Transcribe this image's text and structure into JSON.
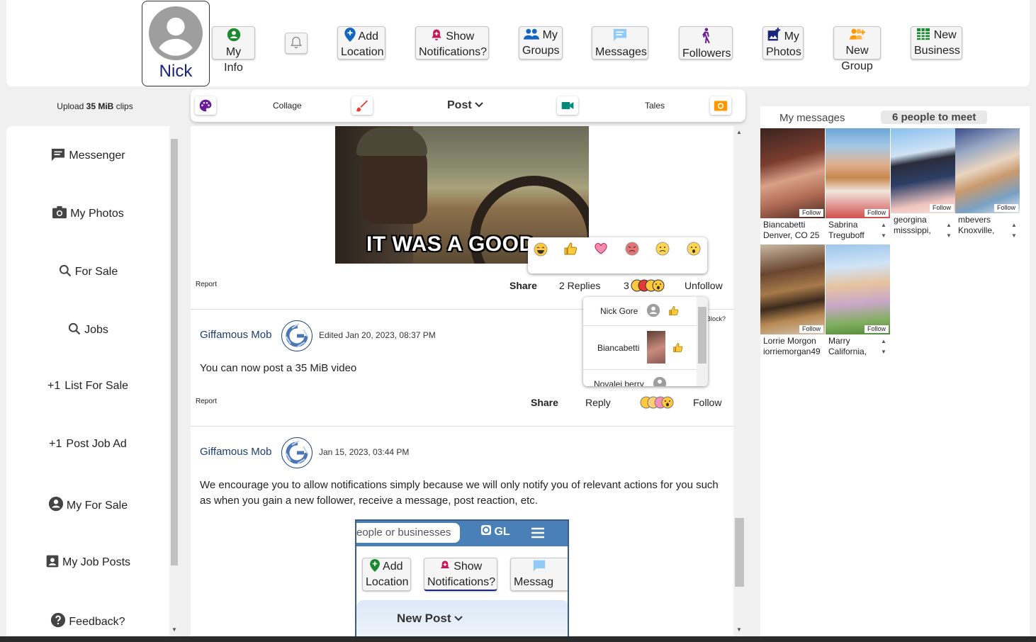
{
  "profile": {
    "name": "Nick"
  },
  "nav": {
    "my_info": "My Info",
    "add": "Add",
    "location": "Location",
    "show": "Show",
    "notifications": "Notifications?",
    "my": "My",
    "groups": "Groups",
    "messages": "Messages",
    "followers": "Followers",
    "photos": "Photos",
    "new": "New",
    "group": "Group",
    "business": "Business"
  },
  "upload": {
    "prefix": "Upload ",
    "size": "35 MiB",
    "suffix": " clips"
  },
  "tabs": {
    "collage": "Collage",
    "post": "Post",
    "tales": "Tales"
  },
  "sidebar": {
    "items": [
      "Messenger",
      "My Photos",
      "For Sale",
      "Jobs",
      "List For Sale",
      "Post Job Ad",
      "My For Sale",
      "My Job Posts",
      "Feedback?"
    ],
    "plus": "+1"
  },
  "post1": {
    "gif_caption": "IT WAS A GOOD",
    "report": "Report",
    "share": "Share",
    "replies": "2 Replies",
    "reaction_count": "3",
    "follow": "Unfollow"
  },
  "reactions_list": {
    "names": [
      "Nick Gore",
      "Biancabetti",
      "Novalei berry"
    ],
    "block": "Block?"
  },
  "post2": {
    "author": "Giffamous Mob",
    "date": "Edited Jan 20, 2023, 08:37 PM",
    "text": "You can now post a 35 MiB video",
    "report": "Report",
    "share": "Share",
    "reply": "Reply",
    "follow": "Follow"
  },
  "post3": {
    "author": "Giffamous Mob",
    "date": "Jan 15, 2023, 03:44 PM",
    "text": "We encourage you to allow notifications simply because we will only notify you of relevant actions for you such as when you gain a new follower, receive a message, post reaction, etc.",
    "shot": {
      "search": "eople or businesses",
      "logo": "GL",
      "add": "Add",
      "location": "Location",
      "show": "Show",
      "notifications": "Notifications?",
      "messages": "Messag",
      "new_post": "New Post"
    }
  },
  "right": {
    "my_messages": "My messages",
    "people": "6 people to meet",
    "follow": "Follow",
    "cards": [
      {
        "l1": "Biancabetti",
        "l2": "Denver, CO 25"
      },
      {
        "l1": "Sabrina",
        "l2": "Treguboff"
      },
      {
        "l1": "georgina",
        "l2": "misssippi,"
      },
      {
        "l1": "mbevers",
        "l2": "Knoxville,"
      },
      {
        "l1": "Lorrie Morgon",
        "l2": "iorriemorgan49"
      },
      {
        "l1": "Marry",
        "l2": "California,"
      }
    ]
  },
  "colors": {
    "navy": "#1a237e",
    "green": "#1b8a2f",
    "pink": "#c2185b",
    "blue": "#1565c0",
    "orange": "#ff9800",
    "purple": "#6a1b9a"
  }
}
